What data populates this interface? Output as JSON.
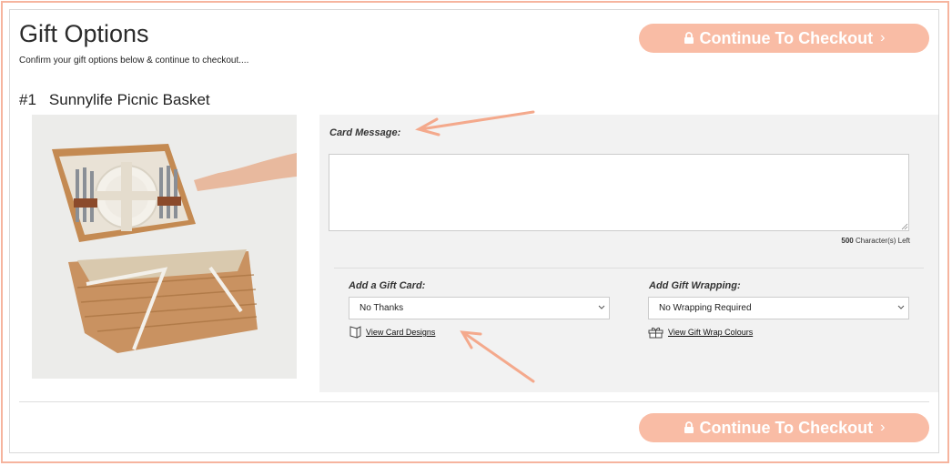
{
  "page": {
    "title": "Gift Options",
    "subtitle": "Confirm your gift options below & continue to checkout....",
    "checkout_label": "Continue To Checkout",
    "checkout_chevron": "›"
  },
  "item": {
    "number": "#1",
    "name": "Sunnylife Picnic Basket"
  },
  "card_message": {
    "label": "Card Message:",
    "value": "",
    "chars_left_count": "500",
    "chars_left_text": "Character(s) Left"
  },
  "gift_card": {
    "label": "Add a Gift Card:",
    "selected": "No Thanks",
    "link": "View Card Designs"
  },
  "gift_wrap": {
    "label": "Add Gift Wrapping:",
    "selected": "No Wrapping Required",
    "link": "View Gift Wrap Colours"
  },
  "colors": {
    "accent": "#f9bca5",
    "frame": "#f6b49e",
    "panel": "#f2f2f2"
  },
  "icons": [
    "lock-icon",
    "chevron-right-icon",
    "chevron-down-icon",
    "card-icon",
    "gift-icon"
  ]
}
